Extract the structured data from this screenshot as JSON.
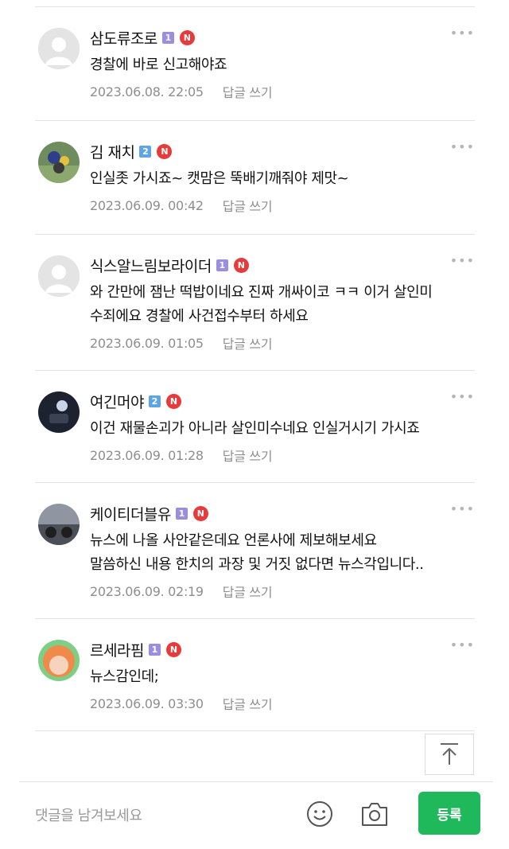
{
  "comments": [
    {
      "author": "삼도류조로",
      "level": "1",
      "new_badge": "N",
      "text": "경찰에 바로 신고해야죠",
      "date": "2023.06.08. 22:05",
      "reply_label": "답글 쓰기",
      "more_icon": "more-dots-icon",
      "avatar": "default-profile-icon"
    },
    {
      "author": "김 재치",
      "level": "2",
      "new_badge": "N",
      "text": "인실좃 가시죠~ 캣맘은 뚝배기깨줘야 제맛~",
      "date": "2023.06.09. 00:42",
      "reply_label": "답글 쓰기",
      "more_icon": "more-dots-icon",
      "avatar": "photo-avatar"
    },
    {
      "author": "식스알느림보라이더",
      "level": "1",
      "new_badge": "N",
      "text": "와 간만에 잼난 떡밥이네요 진짜 개싸이코 ㅋㅋ 이거 살인미\n수죄에요 경찰에 사건접수부터 하세요",
      "date": "2023.06.09. 01:05",
      "reply_label": "답글 쓰기",
      "more_icon": "more-dots-icon",
      "avatar": "default-profile-icon"
    },
    {
      "author": "여긴머야",
      "level": "2",
      "new_badge": "N",
      "text": "이건 재물손괴가 아니라 살인미수네요 인실거시기 가시죠",
      "date": "2023.06.09. 01:28",
      "reply_label": "답글 쓰기",
      "more_icon": "more-dots-icon",
      "avatar": "photo-avatar"
    },
    {
      "author": "케이티더블유",
      "level": "1",
      "new_badge": "N",
      "text": "뉴스에 나올 사안같은데요 언론사에 제보해보세요\n말씀하신 내용 한치의 과장 및 거짓 없다면 뉴스각입니다..",
      "date": "2023.06.09. 02:19",
      "reply_label": "답글 쓰기",
      "more_icon": "more-dots-icon",
      "avatar": "photo-avatar"
    },
    {
      "author": "르세라핌",
      "level": "1",
      "new_badge": "N",
      "text": "뉴스감인데;",
      "date": "2023.06.09. 03:30",
      "reply_label": "답글 쓰기",
      "more_icon": "more-dots-icon",
      "avatar": "photo-avatar"
    }
  ],
  "comment_input": {
    "placeholder": "댓글을 남겨보세요"
  },
  "submit_label": "등록",
  "icons": {
    "emoji": "smiley-icon",
    "camera": "camera-icon",
    "scroll_top": "arrow-up-icon"
  },
  "colors": {
    "submit_green": "#1fb85a",
    "new_badge_red": "#e83a3a",
    "level1": "#9b8de0",
    "level2": "#5ea5e8",
    "meta_gray": "#8e8e8e"
  }
}
